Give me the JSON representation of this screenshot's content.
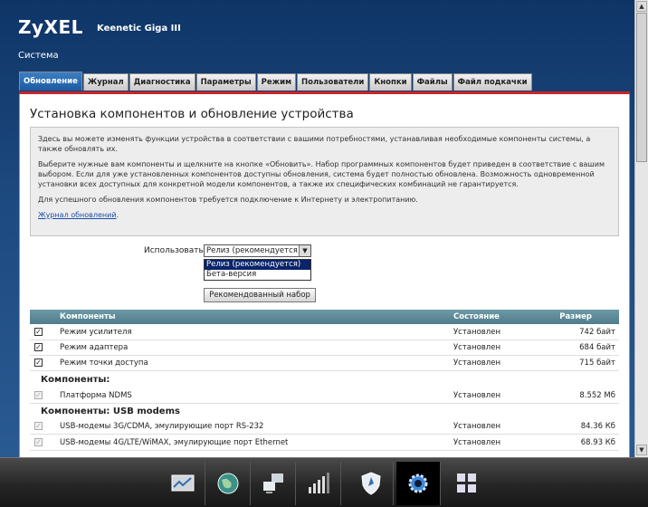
{
  "header": {
    "logo": "ZyXEL",
    "model": "Keenetic Giga III",
    "section": "Система"
  },
  "tabs": [
    "Обновление",
    "Журнал",
    "Диагностика",
    "Параметры",
    "Режим",
    "Пользователи",
    "Кнопки",
    "Файлы",
    "Файл подкачки"
  ],
  "active_tab": "Обновление",
  "page": {
    "title": "Установка компонентов и обновление устройства",
    "info": {
      "p1": "Здесь вы можете изменять функции устройства в соответствии с вашими потребностями, устанавливая необходимые компоненты системы, а также обновлять их.",
      "p2": "Выберите нужные вам компоненты и щелкните на кнопке «Обновить». Набор программных компонентов будет приведен в соответствие с вашим выбором. Если для уже установленных компонентов доступны обновления, система будет полностью обновлена. Возможность одновременной установки всех доступных для конкретной модели компонентов, а также их специфических комбинаций не гарантируется.",
      "p3": "Для успешного обновления компонентов требуется подключение к Интернету и электропитанию.",
      "link": "Журнал обновлений"
    },
    "use_label": "Использовать:",
    "select_value": "Релиз (рекомендуется)",
    "select_options": [
      "Релиз (рекомендуется)",
      "Бета-версия"
    ],
    "recommended_button": "Рекомендованный набор"
  },
  "table": {
    "headers": {
      "name": "Компоненты",
      "status": "Состояние",
      "size": "Размер"
    },
    "mode_rows": [
      {
        "name": "Режим усилителя",
        "status": "Установлен",
        "size": "742 байт",
        "checked": true
      },
      {
        "name": "Режим адаптера",
        "status": "Установлен",
        "size": "684 байт",
        "checked": true
      },
      {
        "name": "Режим точки доступа",
        "status": "Установлен",
        "size": "715 байт",
        "checked": true
      }
    ],
    "group1": "Компоненты:",
    "core_rows": [
      {
        "name": "Платформа NDMS",
        "status": "Установлен",
        "size": "8.552 Мб",
        "checked": true
      }
    ],
    "group2": "Компоненты: USB modems",
    "usb_rows": [
      {
        "name": "USB-модемы 3G/CDMA, эмулирующие порт RS-232",
        "status": "Установлен",
        "size": "84.36 Кб",
        "checked": true
      },
      {
        "name": "USB-модемы 4G/LTE/WiMAX, эмулирующие порт Ethernet",
        "status": "Установлен",
        "size": "68.93 Кб",
        "checked": true
      }
    ]
  },
  "taskbar": [
    "monitor-icon",
    "globe-icon",
    "network-icon",
    "signal-icon",
    "shield-icon",
    "gear-icon",
    "apps-icon"
  ],
  "colors": {
    "accent_tab": "#1b5aa0",
    "red_line": "#c8242b",
    "table_header": "#5a8696",
    "dropdown_highlight": "#0a246a"
  }
}
